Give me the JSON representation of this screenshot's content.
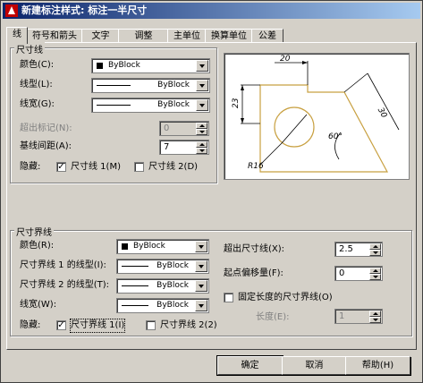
{
  "window": {
    "title": "新建标注样式: 标注一半尺寸"
  },
  "tabs": [
    {
      "label": "线"
    },
    {
      "label": "符号和箭头"
    },
    {
      "label": "文字"
    },
    {
      "label": "调整"
    },
    {
      "label": "主单位"
    },
    {
      "label": "换算单位"
    },
    {
      "label": "公差"
    }
  ],
  "dim_lines": {
    "group_title": "尺寸线",
    "color_label": "颜色(C):",
    "color_value": "ByBlock",
    "linetype_label": "线型(L):",
    "linetype_value": "ByBlock",
    "lineweight_label": "线宽(G):",
    "lineweight_value": "ByBlock",
    "extend_ticks_label": "超出标记(N):",
    "extend_ticks_value": "0",
    "baseline_spacing_label": "基线间距(A):",
    "baseline_spacing_value": "7",
    "suppress_label": "隐藏:",
    "suppress_1_label": "尺寸线 1(M)",
    "suppress_1_checked": true,
    "suppress_2_label": "尺寸线 2(D)",
    "suppress_2_checked": false
  },
  "ext_lines": {
    "group_title": "尺寸界线",
    "color_label": "颜色(R):",
    "color_value": "ByBlock",
    "linetype1_label": "尺寸界线 1 的线型(I):",
    "linetype1_value": "ByBlock",
    "linetype2_label": "尺寸界线 2 的线型(T):",
    "linetype2_value": "ByBlock",
    "lineweight_label": "线宽(W):",
    "lineweight_value": "ByBlock",
    "suppress_label": "隐藏:",
    "suppress_1_label": "尺寸界线 1(I)",
    "suppress_1_checked": true,
    "suppress_2_label": "尺寸界线 2(2)",
    "suppress_2_checked": false,
    "extend_beyond_label": "超出尺寸线(X):",
    "extend_beyond_value": "2.5",
    "offset_label": "起点偏移量(F):",
    "offset_value": "0",
    "fixed_length_label": "固定长度的尺寸界线(O)",
    "fixed_length_checked": false,
    "length_label": "长度(E):",
    "length_value": "1"
  },
  "preview": {
    "dim_top": "20",
    "dim_left": "23",
    "dim_right": "30",
    "dim_angle": "60°",
    "dim_radius": "R16"
  },
  "buttons": {
    "ok": "确定",
    "cancel": "取消",
    "help": "帮助(H)"
  },
  "colors": {
    "title_start": "#0a246a",
    "title_end": "#a6caf0",
    "face": "#d4d0c8",
    "preview_part": "#c8a040"
  }
}
